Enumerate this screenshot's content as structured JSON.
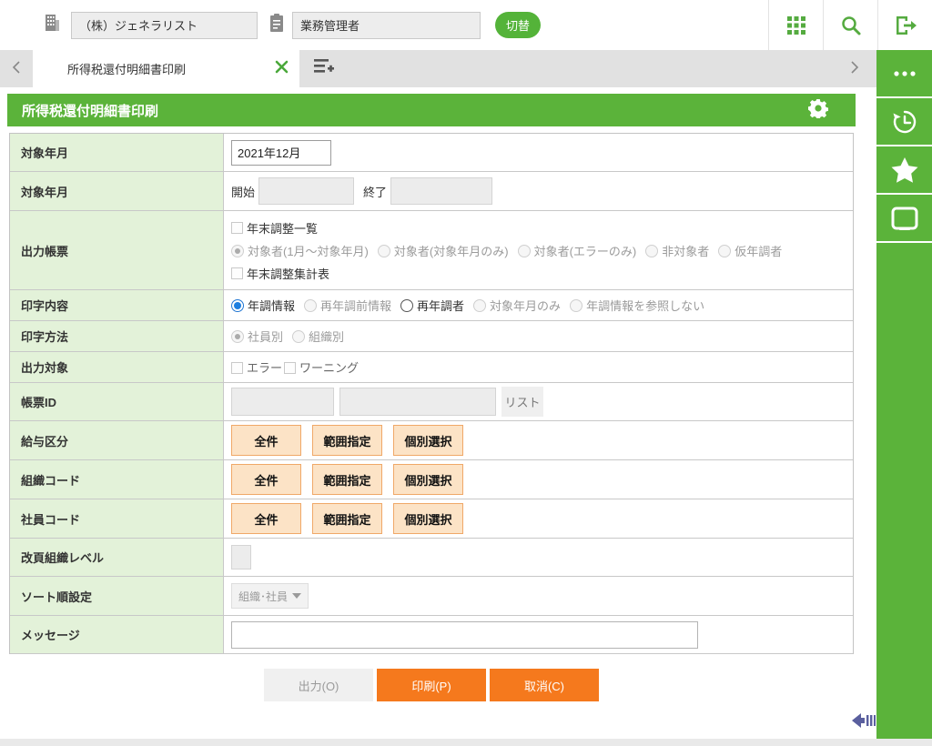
{
  "topbar": {
    "company_value": "（株）ジェネラリスト",
    "role_value": "業務管理者",
    "switch_button": "切替"
  },
  "tab_bar": {
    "active_tab": "所得税還付明細書印刷"
  },
  "page_header": {
    "title": "所得税還付明細書印刷"
  },
  "form": {
    "target_month": {
      "label": "対象年月",
      "value": "2021年12月"
    },
    "target_period": {
      "label": "対象年月",
      "start": "開始",
      "end": "終了"
    },
    "output_report": {
      "label": "出力帳票",
      "check_top": "年末調整一覧",
      "options": [
        "対象者(1月～対象年月)",
        "対象者(対象年月のみ)",
        "対象者(エラーのみ)",
        "非対象者",
        "仮年調者"
      ],
      "check_bottom": "年末調整集計表"
    },
    "print_content": {
      "label": "印字内容",
      "options": [
        "年調情報",
        "再年調前情報",
        "再年調者",
        "対象年月のみ",
        "年調情報を参照しない"
      ]
    },
    "print_method": {
      "label": "印字方法",
      "options": [
        "社員別",
        "組織別"
      ]
    },
    "output_target": {
      "label": "出力対象",
      "options": [
        "エラー",
        "ワーニング"
      ]
    },
    "report_id": {
      "label": "帳票ID",
      "list_button": "リスト"
    },
    "salary_class": {
      "label": "給与区分"
    },
    "org_code": {
      "label": "組織コード"
    },
    "employee_code": {
      "label": "社員コード"
    },
    "page_break_level": {
      "label": "改頁組織レベル"
    },
    "sort_order": {
      "label": "ソート順設定",
      "value": "組織･社員"
    },
    "message": {
      "label": "メッセージ"
    },
    "selection_buttons": {
      "all": "全件",
      "range": "範囲指定",
      "individual": "個別選択"
    }
  },
  "actions": {
    "output": "出力(O)",
    "print": "印刷(P)",
    "cancel": "取消(C)"
  },
  "colors": {
    "green": "#5bb33a",
    "orange": "#f5791d",
    "radio_selected_blue": "#1e7fe0",
    "label_cell_green": "#e3f2d9"
  }
}
